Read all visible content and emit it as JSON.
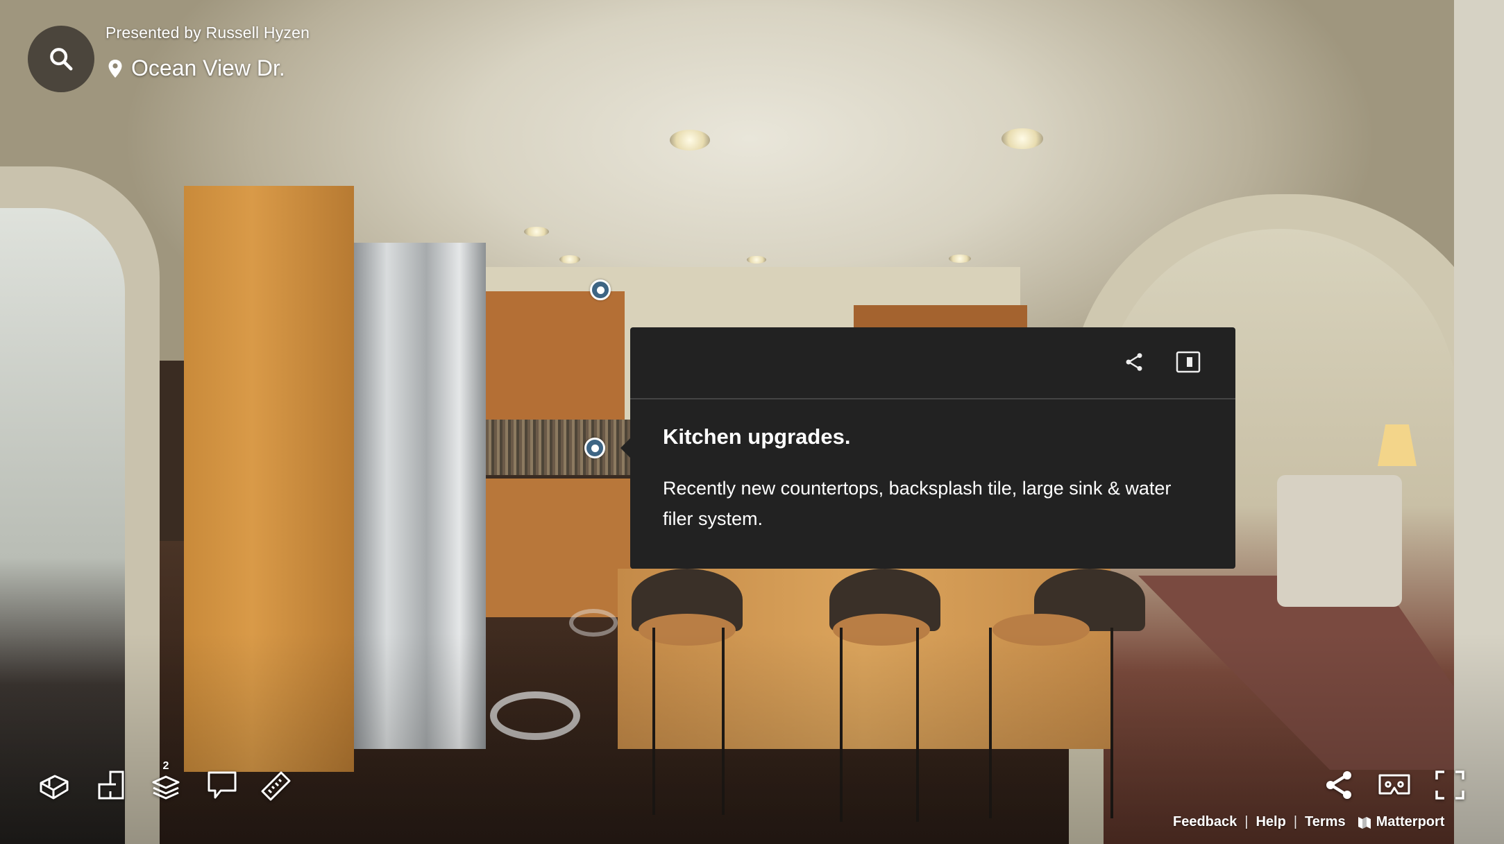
{
  "header": {
    "presented_by": "Presented by Russell Hyzen",
    "address": "Ocean View Dr.",
    "icons": {
      "search": "search-icon",
      "location": "map-pin-icon"
    }
  },
  "tag_card": {
    "title": "Kitchen upgrades.",
    "description": "Recently new countertops, backsplash tile, large sink & water filer system.",
    "icons": {
      "share": "share-icon",
      "panel": "side-panel-icon"
    },
    "background": "#222222"
  },
  "tag_pins": {
    "count": 2,
    "color": "#3e6584"
  },
  "toolbar_left": [
    {
      "name": "dollhouse-view",
      "icon": "dollhouse-icon"
    },
    {
      "name": "floorplan-view",
      "icon": "floorplan-icon"
    },
    {
      "name": "floor-selector",
      "icon": "layers-icon",
      "badge": "2"
    },
    {
      "name": "mattertags-toggle",
      "icon": "speech-bubble-icon"
    },
    {
      "name": "measurement-tool",
      "icon": "ruler-icon"
    }
  ],
  "toolbar_right": [
    {
      "name": "share",
      "icon": "share-icon"
    },
    {
      "name": "vr-mode",
      "icon": "vr-headset-icon"
    },
    {
      "name": "fullscreen",
      "icon": "fullscreen-icon"
    }
  ],
  "footer": {
    "links": [
      "Feedback",
      "Help",
      "Terms"
    ],
    "separator": "|",
    "brand": "Matterport"
  }
}
